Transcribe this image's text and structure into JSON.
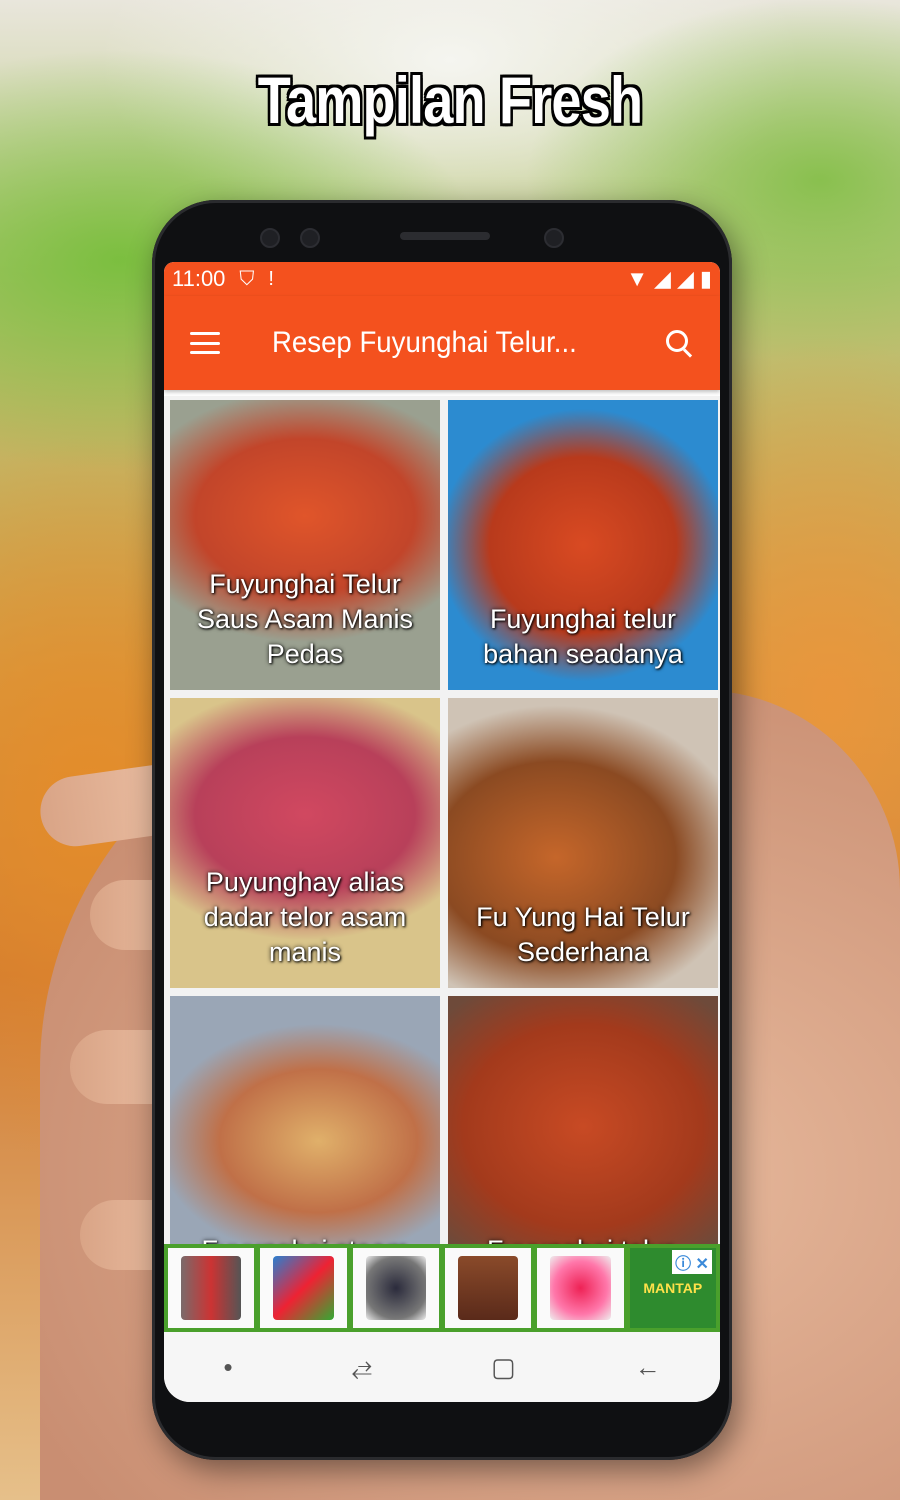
{
  "headline": "Tampilan Fresh",
  "status_bar": {
    "time": "11:00",
    "icons": [
      "shield-check-icon",
      "alert-icon",
      "wifi-icon",
      "signal-icon",
      "battery-icon"
    ]
  },
  "app_bar": {
    "title": "Resep Fuyunghai Telur...",
    "accent_color": "#f4511e",
    "menu_icon": "hamburger-menu-icon",
    "search_icon": "search-icon"
  },
  "recipes": [
    {
      "title": "Fuyunghai Telur Saus Asam Manis Pedas"
    },
    {
      "title": "Fuyunghai telur bahan seadanya"
    },
    {
      "title": "Puyunghay alias dadar telor asam manis"
    },
    {
      "title": "Fu Yung Hai Telur Sederhana"
    },
    {
      "title": "Fuyunghai steam"
    },
    {
      "title": "Fuyunghai telur,"
    }
  ],
  "ad_banner": {
    "last_item_text": "MANTAP",
    "badge": "ⓘ ✕"
  },
  "nav_bar": {
    "dot": "•",
    "recent": "⥄",
    "home": "▢",
    "back": "←"
  }
}
